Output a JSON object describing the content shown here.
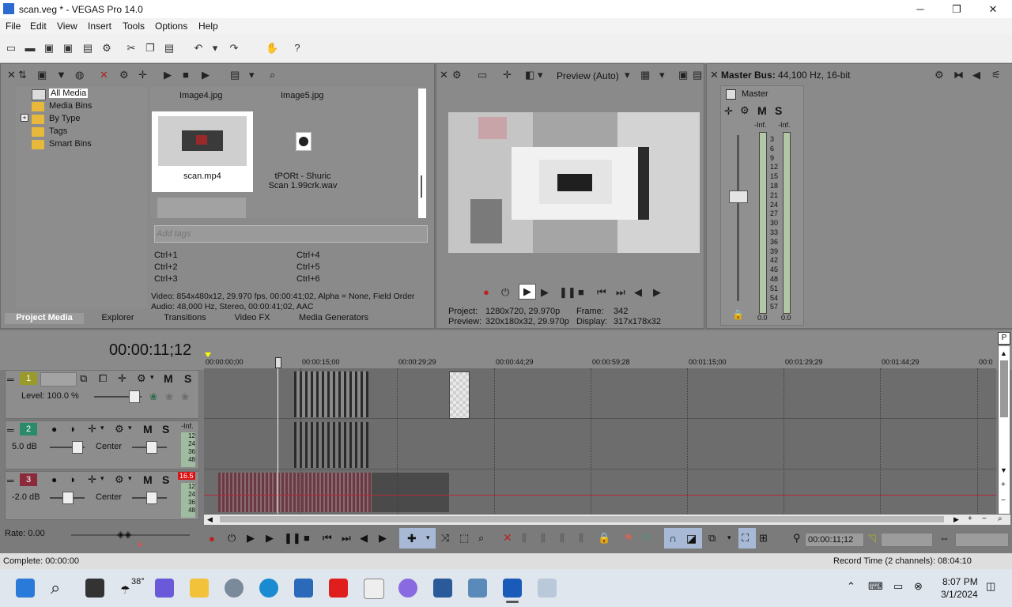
{
  "window": {
    "title": "scan.veg * - VEGAS Pro 14.0",
    "minimize": "─",
    "maximize": "❐",
    "close": "✕"
  },
  "menu": [
    "File",
    "Edit",
    "View",
    "Insert",
    "Tools",
    "Options",
    "Help"
  ],
  "media": {
    "tree": [
      "All Media",
      "Media Bins",
      "By Type",
      "Tags",
      "Smart Bins"
    ],
    "tree_expand": "+",
    "files": [
      {
        "name": "Image4.jpg"
      },
      {
        "name": "Image5.jpg"
      },
      {
        "name": "scan.mp4"
      },
      {
        "name": "tPORt - Shuric Scan 1.99crk.wav"
      }
    ],
    "tags_placeholder": "Add tags",
    "shortcuts": [
      "Ctrl+1",
      "Ctrl+2",
      "Ctrl+3",
      "Ctrl+4",
      "Ctrl+5",
      "Ctrl+6"
    ],
    "info_video": "Video: 854x480x12, 29.970 fps, 00:00:41;02, Alpha = None, Field Order",
    "info_audio": "Audio: 48,000 Hz, Stereo, 00:00:41;02, AAC",
    "tabs": [
      "Project Media",
      "Explorer",
      "Transitions",
      "Video FX",
      "Media Generators"
    ]
  },
  "preview": {
    "mode": "Preview (Auto)",
    "project_label": "Project:",
    "project_value": "1280x720, 29.970p",
    "preview_label": "Preview:",
    "preview_value": "320x180x32, 29.970p",
    "frame_label": "Frame:",
    "frame_value": "342",
    "display_label": "Display:",
    "display_value": "317x178x32"
  },
  "master": {
    "title": "Master Bus:",
    "subtitle": "44,100 Hz, 16-bit",
    "bus_name": "Master",
    "m": "M",
    "s": "S",
    "peak_left": "-Inf.",
    "peak_right": "-Inf.",
    "scale": [
      "3",
      "6",
      "9",
      "12",
      "15",
      "18",
      "21",
      "24",
      "27",
      "30",
      "33",
      "36",
      "39",
      "42",
      "45",
      "48",
      "51",
      "54",
      "57"
    ],
    "level_left": "0.0",
    "level_right": "0.0"
  },
  "timeline": {
    "timecode": "00:00:11;12",
    "ruler": [
      "00:00:00;00",
      "00:00:15;00",
      "00:00:29;29",
      "00:00:44;29",
      "00:00:59;28",
      "00:01:15;00",
      "00:01:29;29",
      "00:01:44;29",
      "00:0"
    ],
    "tracks": [
      {
        "num": "1",
        "type": "video",
        "level_label": "Level: 100.0 %",
        "color": "#9a9a2a"
      },
      {
        "num": "2",
        "type": "audio",
        "vol": "5.0 dB",
        "pan": "Center",
        "color": "#2a8a6a",
        "peak": "-Inf."
      },
      {
        "num": "3",
        "type": "audio",
        "vol": "-2.0 dB",
        "pan": "Center",
        "color": "#8a2a3a",
        "peak": "16.5"
      }
    ],
    "track_meter_scale": [
      "12",
      "24",
      "36",
      "48"
    ],
    "m": "M",
    "s": "S",
    "rate": "Rate: 0.00",
    "cursor_time": "00:00:11;12"
  },
  "status": {
    "left": "Complete: 00:00:00",
    "right": "Record Time (2 channels): 08:04:10"
  },
  "taskbar": {
    "weather": "38°",
    "time": "8:07 PM",
    "date": "3/1/2024"
  }
}
